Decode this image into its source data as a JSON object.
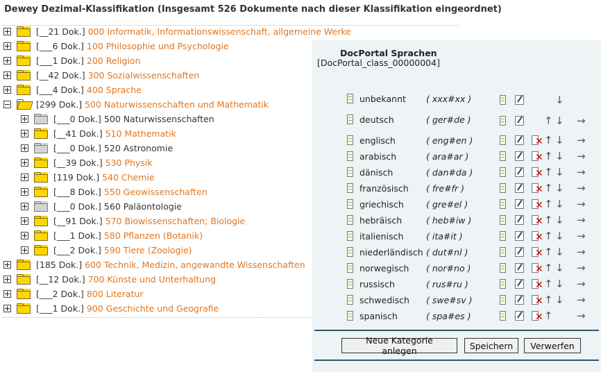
{
  "header": {
    "title": "Dewey Dezimal-Klassifikation (Insgesamt 526 Dokumente nach dieser Klassifikation eingeordnet)"
  },
  "tree": {
    "items": [
      {
        "count": "[__21 Dok.]",
        "label": "000 Informatik, Informationswissenschaft, allgemeine Werke"
      },
      {
        "count": "[___6 Dok.]",
        "label": "100 Philosophie und Psychologie"
      },
      {
        "count": "[___1 Dok.]",
        "label": "200 Religion"
      },
      {
        "count": "[__42 Dok.]",
        "label": "300 Sozialwissenschaften"
      },
      {
        "count": "[___4 Dok.]",
        "label": "400 Sprache"
      },
      {
        "count": "[299 Dok.]",
        "label": "500 Naturwissenschaften und Mathematik"
      },
      {
        "count": "[___0 Dok.]",
        "label": "500 Naturwissenschaften"
      },
      {
        "count": "[__41 Dok.]",
        "label": "510 Mathematik"
      },
      {
        "count": "[___0 Dok.]",
        "label": "520 Astronomie"
      },
      {
        "count": "[__39 Dok.]",
        "label": "530 Physik"
      },
      {
        "count": "[119 Dok.]",
        "label": "540 Chemie"
      },
      {
        "count": "[___8 Dok.]",
        "label": "550 Geowissenschaften"
      },
      {
        "count": "[___0 Dok.]",
        "label": "560 Paläontologie"
      },
      {
        "count": "[__91 Dok.]",
        "label": "570 Biowissenschaften; Biologie"
      },
      {
        "count": "[___1 Dok.]",
        "label": "580 Pflanzen (Botanik)"
      },
      {
        "count": "[___2 Dok.]",
        "label": "590 Tiere (Zoologie)"
      },
      {
        "count": "[185 Dok.]",
        "label": "600 Technik, Medizin, angewandte Wissenschaften"
      },
      {
        "count": "[__12 Dok.]",
        "label": "700 Künste und Unterhaltung"
      },
      {
        "count": "[___2 Dok.]",
        "label": "800 Literatur"
      },
      {
        "count": "[___1 Dok.]",
        "label": "900 Geschichte und Geografie"
      }
    ]
  },
  "panel": {
    "title": "DocPortal Sprachen",
    "classification_id": "[DocPortal_class_00000004]",
    "languages": [
      {
        "name": "unbekannt",
        "code": "( xxx#xx )"
      },
      {
        "name": "deutsch",
        "code": "( ger#de )"
      },
      {
        "name": "englisch",
        "code": "( eng#en )"
      },
      {
        "name": "arabisch",
        "code": "( ara#ar )"
      },
      {
        "name": "dänisch",
        "code": "( dan#da )"
      },
      {
        "name": "französisch",
        "code": "( fre#fr )"
      },
      {
        "name": "griechisch",
        "code": "( gre#el )"
      },
      {
        "name": "hebräisch",
        "code": "( heb#iw )"
      },
      {
        "name": "italienisch",
        "code": "( ita#it )"
      },
      {
        "name": "niederländisch",
        "code": "( dut#nl )"
      },
      {
        "name": "norwegisch",
        "code": "( nor#no )"
      },
      {
        "name": "russisch",
        "code": "( rus#ru )"
      },
      {
        "name": "schwedisch",
        "code": "( swe#sv )"
      },
      {
        "name": "spanisch",
        "code": "( spa#es )"
      }
    ],
    "buttons": {
      "new_category": "Neue Kategorie anlegen",
      "save": "Speichern",
      "discard": "Verwerfen"
    }
  },
  "icons": {
    "expand": "plus-square-icon",
    "collapse": "minus-square-icon",
    "folder": "folder-icon",
    "document": "document-icon",
    "edit": "edit-icon",
    "delete": "delete-icon",
    "move_up": "arrow-up-icon",
    "move_down": "arrow-down-icon",
    "move_right": "arrow-right-icon"
  },
  "colors": {
    "link": "#e0761f",
    "folder": "#ffd700",
    "folder_empty": "#d4d4d4",
    "panel_bg": "#eef3f6",
    "delete": "#dd0000"
  }
}
